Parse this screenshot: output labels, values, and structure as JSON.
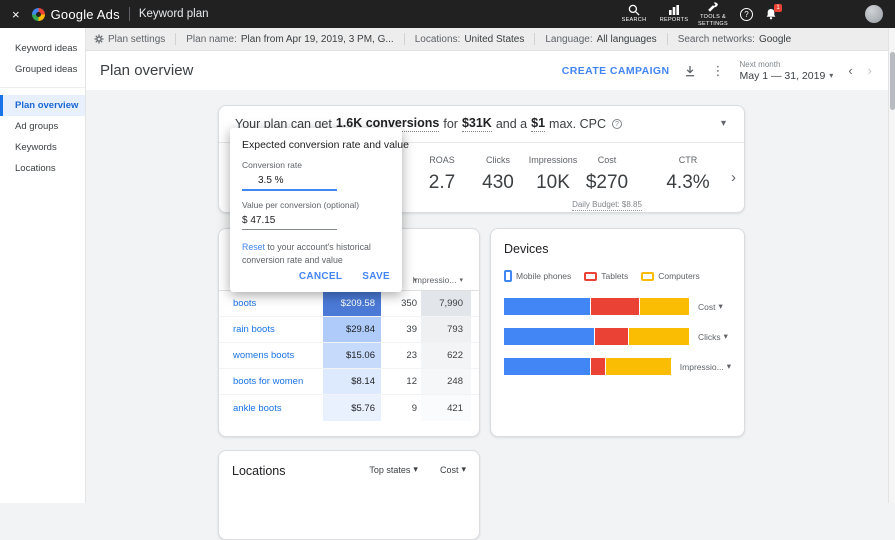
{
  "topbar": {
    "brand": "Google Ads",
    "product": "Keyword plan",
    "search_label": "SEARCH",
    "reports_label": "REPORTS",
    "tools_label": "TOOLS & SETTINGS",
    "badge": "1"
  },
  "icons": {
    "close": "×",
    "help": "?",
    "info": "?",
    "caret_down": "▾",
    "kebab": "⋮",
    "chevron_left": "‹",
    "chevron_right": "›",
    "metrics_next": "›"
  },
  "settings_bar": {
    "plan_settings": "Plan settings",
    "plan_name_label": "Plan name:",
    "plan_name_value": "Plan from Apr 19, 2019, 3 PM, G...",
    "locations_label": "Locations:",
    "locations_value": "United States",
    "language_label": "Language:",
    "language_value": "All languages",
    "networks_label": "Search networks:",
    "networks_value": "Google"
  },
  "sidebar": {
    "items": [
      {
        "label": "Keyword ideas"
      },
      {
        "label": "Grouped ideas"
      },
      {
        "label": "Plan overview"
      },
      {
        "label": "Ad groups"
      },
      {
        "label": "Keywords"
      },
      {
        "label": "Locations"
      }
    ]
  },
  "header": {
    "title": "Plan overview",
    "create_campaign": "CREATE CAMPAIGN",
    "period_label": "Next month",
    "date_range": "May 1 — 31, 2019"
  },
  "banner": {
    "prefix": "Your plan can get",
    "conversions": "1.6K conversions",
    "mid1": "for",
    "cost": "$31K",
    "mid2": "and a",
    "cpc": "$1",
    "suffix": "max. CPC"
  },
  "metrics": {
    "items": [
      {
        "label": "ROAS",
        "value": "2.7"
      },
      {
        "label": "Clicks",
        "value": "430"
      },
      {
        "label": "Impressions",
        "value": "10K"
      },
      {
        "label": "Cost",
        "value": "$270",
        "sub": "Daily Budget: $8.85"
      },
      {
        "label": "CTR",
        "value": "4.3%"
      }
    ]
  },
  "dialog": {
    "title": "Expected conversion rate and value",
    "rate_label": "Conversion rate",
    "rate_value": "3.5 %",
    "value_label": "Value per conversion (optional)",
    "value_value": "$ 47.15",
    "reset_link": "Reset",
    "reset_text": "to your account's historical conversion rate and value",
    "cancel": "CANCEL",
    "save": "SAVE"
  },
  "keywords": {
    "impressions_header": "Impressio...",
    "rows": [
      {
        "keyword": "boots",
        "cost": "$209.58",
        "clicks": "350",
        "impressions": "7,990",
        "cost_bg": "#4a7ad6",
        "cost_fg": "#ffffff",
        "imp_bg": "#e2e5e9"
      },
      {
        "keyword": "rain boots",
        "cost": "$29.84",
        "clicks": "39",
        "impressions": "793",
        "cost_bg": "#aecbfa",
        "cost_fg": "#202124",
        "imp_bg": "#eef0f2"
      },
      {
        "keyword": "womens boots",
        "cost": "$15.06",
        "clicks": "23",
        "impressions": "622",
        "cost_bg": "#c6dafc",
        "cost_fg": "#202124",
        "imp_bg": "#f2f4f5"
      },
      {
        "keyword": "boots for women",
        "cost": "$8.14",
        "clicks": "12",
        "impressions": "248",
        "cost_bg": "#dde9fd",
        "cost_fg": "#202124",
        "imp_bg": "#f6f7f8"
      },
      {
        "keyword": "ankle boots",
        "cost": "$5.76",
        "clicks": "9",
        "impressions": "421",
        "cost_bg": "#eaf1fe",
        "cost_fg": "#202124",
        "imp_bg": "#fafbfc"
      }
    ]
  },
  "devices": {
    "title": "Devices",
    "legend": [
      {
        "label": "Mobile phones",
        "color": "#4285f4"
      },
      {
        "label": "Tablets",
        "color": "#ea4335"
      },
      {
        "label": "Computers",
        "color": "#fbbc04"
      }
    ],
    "bars": [
      {
        "metric": "Cost",
        "segments": [
          {
            "pct": 47,
            "color": "#4285f4"
          },
          {
            "pct": 26,
            "color": "#ea4335"
          },
          {
            "pct": 27,
            "color": "#fbbc04"
          }
        ]
      },
      {
        "metric": "Clicks",
        "segments": [
          {
            "pct": 49,
            "color": "#4285f4"
          },
          {
            "pct": 18,
            "color": "#ea4335"
          },
          {
            "pct": 33,
            "color": "#fbbc04"
          }
        ]
      },
      {
        "metric": "Impressio...",
        "segments": [
          {
            "pct": 52,
            "color": "#4285f4"
          },
          {
            "pct": 9,
            "color": "#ea4335"
          },
          {
            "pct": 39,
            "color": "#fbbc04"
          }
        ]
      }
    ]
  },
  "locations": {
    "title": "Locations",
    "filter1": "Top states",
    "filter2": "Cost"
  }
}
